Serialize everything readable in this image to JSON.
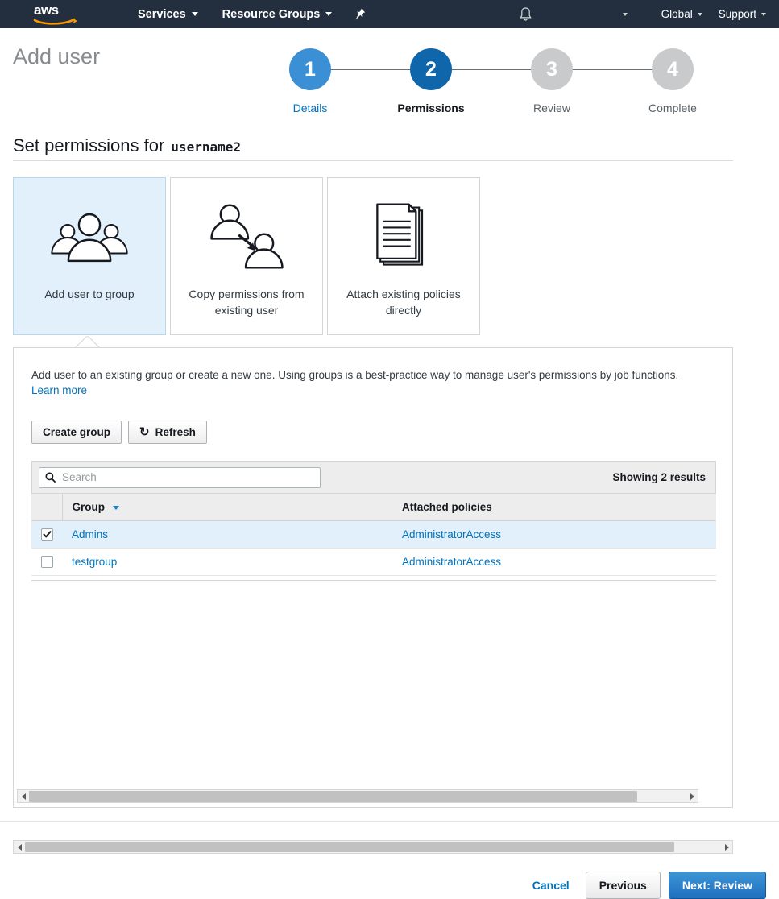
{
  "navbar": {
    "logo_alt": "aws",
    "services_label": "Services",
    "resource_groups_label": "Resource Groups",
    "pin_icon": "pin-icon",
    "bell_icon": "bell-icon",
    "account_label": "",
    "region_label": "Global",
    "support_label": "Support",
    "bg_color": "#232f3e"
  },
  "page": {
    "title": "Add user",
    "section_title": "Set permissions for",
    "username": "username2"
  },
  "stepper": {
    "steps": [
      {
        "number": "1",
        "label": "Details",
        "state": "done",
        "color": "#3b8fd4"
      },
      {
        "number": "2",
        "label": "Permissions",
        "state": "current",
        "color": "#1066ab"
      },
      {
        "number": "3",
        "label": "Review",
        "state": "todo",
        "color": "#c8cacc"
      },
      {
        "number": "4",
        "label": "Complete",
        "state": "todo",
        "color": "#c8cacc"
      }
    ]
  },
  "options": [
    {
      "label": "Add user to group",
      "icon": "group-of-users-icon",
      "selected": true
    },
    {
      "label": "Copy permissions from existing user",
      "icon": "copy-user-icon",
      "selected": false
    },
    {
      "label": "Attach existing policies directly",
      "icon": "documents-icon",
      "selected": false
    }
  ],
  "panel": {
    "description": "Add user to an existing group or create a new one. Using groups is a best-practice way to manage user's permissions by job functions.",
    "learn_more": "Learn more",
    "create_group_label": "Create group",
    "refresh_label": "Refresh",
    "refresh_icon": "refresh-icon"
  },
  "search": {
    "placeholder": "Search",
    "value": "",
    "icon": "search-icon"
  },
  "table": {
    "results_text": "Showing 2 results",
    "columns": [
      "",
      "Group",
      "Attached policies"
    ],
    "sort_column": "Group",
    "sort_direction": "desc",
    "rows": [
      {
        "checked": true,
        "group": "Admins",
        "policies": "AdministratorAccess"
      },
      {
        "checked": false,
        "group": "testgroup",
        "policies": "AdministratorAccess"
      }
    ]
  },
  "footer": {
    "cancel_label": "Cancel",
    "previous_label": "Previous",
    "next_label": "Next: Review"
  },
  "colors": {
    "link": "#0073bb",
    "selected_row": "#e1f0fa",
    "primary_button": "#1f6fc0"
  }
}
